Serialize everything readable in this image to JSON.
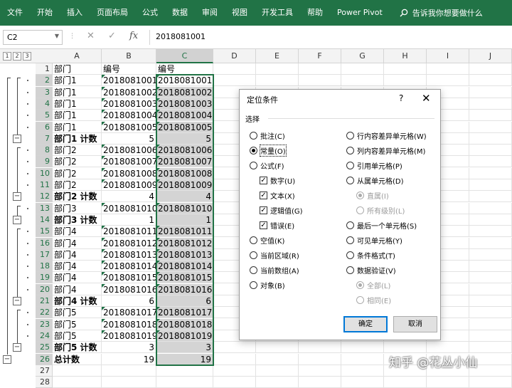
{
  "ribbon": {
    "tabs": [
      "文件",
      "开始",
      "插入",
      "页面布局",
      "公式",
      "数据",
      "审阅",
      "视图",
      "开发工具",
      "帮助",
      "Power Pivot"
    ],
    "tell_me": "告诉我你想要做什么"
  },
  "formula_bar": {
    "name_box": "C2",
    "cancel": "✕",
    "enter": "✓",
    "fx": "fx",
    "value": "2018081001"
  },
  "sheet": {
    "levels": [
      "1",
      "2",
      "3"
    ],
    "columns": [
      "A",
      "B",
      "C",
      "D",
      "E",
      "F",
      "G",
      "H",
      "I",
      "J"
    ],
    "rows": [
      {
        "n": "1",
        "a": "部门",
        "b": "编号",
        "c": "编号"
      },
      {
        "n": "2",
        "a": "部门1",
        "b": "2018081001",
        "c": "2018081001"
      },
      {
        "n": "3",
        "a": "部门1",
        "b": "2018081002",
        "c": "2018081002"
      },
      {
        "n": "4",
        "a": "部门1",
        "b": "2018081003",
        "c": "2018081003"
      },
      {
        "n": "5",
        "a": "部门1",
        "b": "2018081004",
        "c": "2018081004"
      },
      {
        "n": "6",
        "a": "部门1",
        "b": "2018081005",
        "c": "2018081005"
      },
      {
        "n": "7",
        "a": "部门1 计数",
        "b": "5",
        "c": "5"
      },
      {
        "n": "8",
        "a": "部门2",
        "b": "2018081006",
        "c": "2018081006"
      },
      {
        "n": "9",
        "a": "部门2",
        "b": "2018081007",
        "c": "2018081007"
      },
      {
        "n": "10",
        "a": "部门2",
        "b": "2018081008",
        "c": "2018081008"
      },
      {
        "n": "11",
        "a": "部门2",
        "b": "2018081009",
        "c": "2018081009"
      },
      {
        "n": "12",
        "a": "部门2 计数",
        "b": "4",
        "c": "4"
      },
      {
        "n": "13",
        "a": "部门3",
        "b": "2018081010",
        "c": "2018081010"
      },
      {
        "n": "14",
        "a": "部门3 计数",
        "b": "1",
        "c": "1"
      },
      {
        "n": "15",
        "a": "部门4",
        "b": "2018081011",
        "c": "2018081011"
      },
      {
        "n": "16",
        "a": "部门4",
        "b": "2018081012",
        "c": "2018081012"
      },
      {
        "n": "17",
        "a": "部门4",
        "b": "2018081013",
        "c": "2018081013"
      },
      {
        "n": "18",
        "a": "部门4",
        "b": "2018081014",
        "c": "2018081014"
      },
      {
        "n": "19",
        "a": "部门4",
        "b": "2018081015",
        "c": "2018081015"
      },
      {
        "n": "20",
        "a": "部门4",
        "b": "2018081016",
        "c": "2018081016"
      },
      {
        "n": "21",
        "a": "部门4 计数",
        "b": "6",
        "c": "6"
      },
      {
        "n": "22",
        "a": "部门5",
        "b": "2018081017",
        "c": "2018081017"
      },
      {
        "n": "23",
        "a": "部门5",
        "b": "2018081018",
        "c": "2018081018"
      },
      {
        "n": "24",
        "a": "部门5",
        "b": "2018081019",
        "c": "2018081019"
      },
      {
        "n": "25",
        "a": "部门5 计数",
        "b": "3",
        "c": "3"
      },
      {
        "n": "26",
        "a": "总计数",
        "b": "19",
        "c": "19"
      },
      {
        "n": "27",
        "a": "",
        "b": "",
        "c": ""
      },
      {
        "n": "28",
        "a": "",
        "b": "",
        "c": ""
      }
    ],
    "selection_fill": "#d4d4d4",
    "selection_border": "#217346"
  },
  "dialog": {
    "title": "定位条件",
    "help": "?",
    "close": "✕",
    "section": "选择",
    "left": {
      "comments": "批注(C)",
      "constants": "常量(O)",
      "formulas": "公式(F)",
      "numbers": "数字(U)",
      "text": "文本(X)",
      "logicals": "逻辑值(G)",
      "errors": "错误(E)",
      "blanks": "空值(K)",
      "current_region": "当前区域(R)",
      "current_array": "当前数组(A)",
      "objects": "对象(B)"
    },
    "right": {
      "row_diff": "行内容差异单元格(W)",
      "col_diff": "列内容差异单元格(M)",
      "precedents": "引用单元格(P)",
      "dependents": "从属单元格(D)",
      "direct": "直属(I)",
      "all_levels": "所有级别(L)",
      "last_cell": "最后一个单元格(S)",
      "visible": "可见单元格(Y)",
      "cond_format": "条件格式(T)",
      "data_validation": "数据验证(V)",
      "all": "全部(L)",
      "same": "相同(E)"
    },
    "ok": "确定",
    "cancel": "取消"
  },
  "watermark": "知乎 @花丛小仙"
}
